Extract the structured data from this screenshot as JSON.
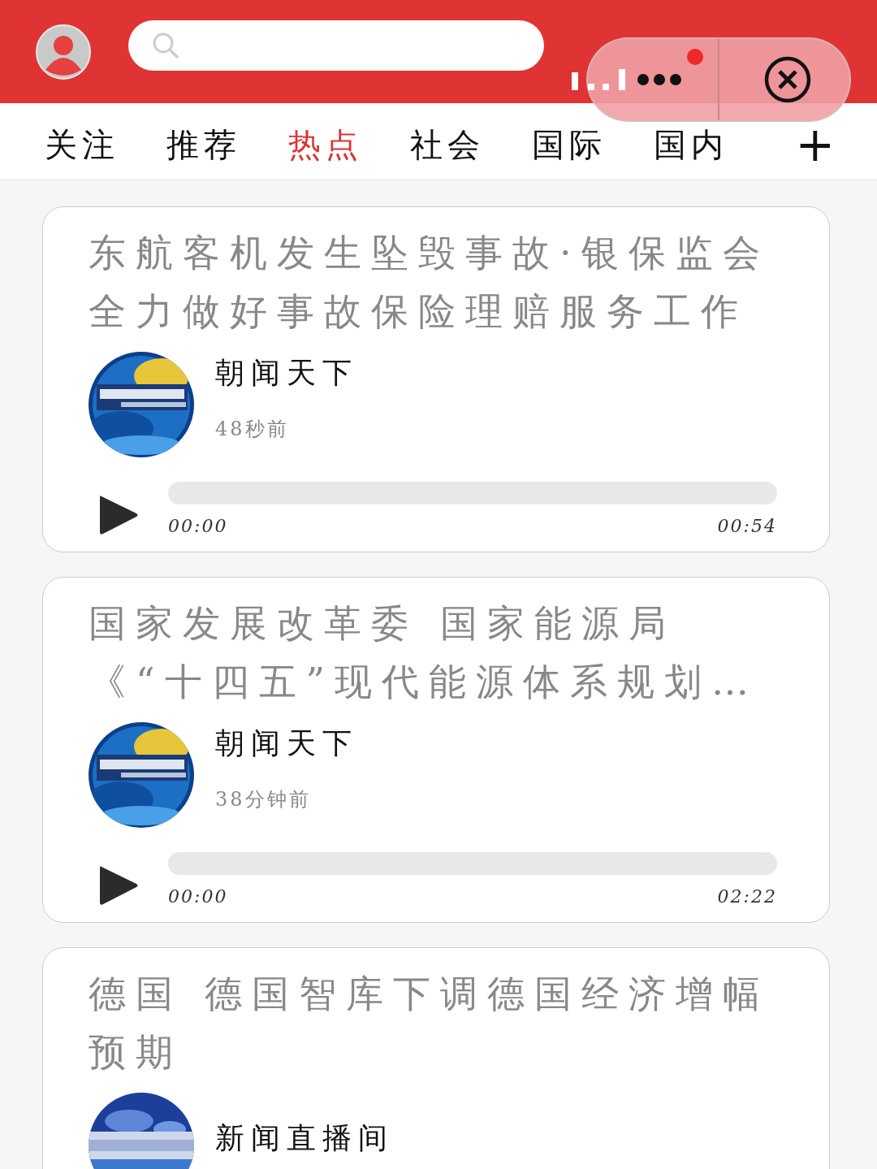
{
  "tabs": [
    {
      "label": "关注",
      "selected": false
    },
    {
      "label": "推荐",
      "selected": false
    },
    {
      "label": "热点",
      "selected": true
    },
    {
      "label": "社会",
      "selected": false
    },
    {
      "label": "国际",
      "selected": false
    },
    {
      "label": "国内",
      "selected": false
    }
  ],
  "add_tab": "+",
  "notification_dot": true,
  "news": [
    {
      "title": "东航客机发生坠毁事故·银保监会全力做好事故保险理赔服务工作",
      "source": "朝闻天下",
      "time": "48秒前",
      "player": {
        "level": 0,
        "elapsed": "00:00",
        "duration": "00:54"
      }
    },
    {
      "title": "国家发展改革委 国家能源局《“十四五”现代能源体系规划…",
      "source": "朝闻天下",
      "time": "38分钟前",
      "player": {
        "level": 0,
        "elapsed": "00:00",
        "duration": "02:22"
      }
    },
    {
      "title": "德国 德国智库下调德国经济增幅预期",
      "source": "新闻直播间"
    }
  ]
}
